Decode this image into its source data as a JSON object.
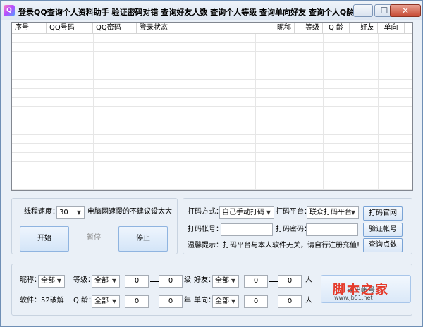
{
  "window": {
    "title": "登录QQ查询个人资料助手   验证密码对错  查询好友人数  查询个人等级  查询单向好友  查询个人Q龄 ...",
    "icon_text": "Q",
    "minimize_glyph": "—",
    "maximize_glyph": "☐",
    "close_glyph": "✕"
  },
  "table": {
    "columns": [
      "序号",
      "QQ号码",
      "QQ密码",
      "登录状态",
      "昵称",
      "等级",
      "Q 龄",
      "好友",
      "单向"
    ]
  },
  "speed": {
    "label": "线程速度：",
    "value": "30",
    "note": "电脑网速慢的不建议设太大"
  },
  "controls": {
    "start": "开始",
    "pause": "暂停",
    "stop": "停止"
  },
  "captcha": {
    "method_label": "打码方式：",
    "method_value": "自己手动打码",
    "platform_label": "打码平台：",
    "platform_value": "联众打码平台",
    "official_button": "打码官网",
    "account_label": "打码帐号：",
    "account_value": "",
    "password_label": "打码密码：",
    "password_value": "",
    "verify_button": "验证帐号",
    "points_button": "查询点数",
    "hint": "温馨提示：打码平台与本人软件无关，请自行注册充值!"
  },
  "filters": {
    "nickname_label": "昵称：",
    "nickname_value": "全部",
    "level_label": "等级：",
    "level_value": "全部",
    "level_min": "0",
    "level_max": "0",
    "level_unit": "级",
    "friends_label": "好友：",
    "friends_value": "全部",
    "friends_min": "0",
    "friends_max": "0",
    "friends_unit": "人",
    "software_label": "软件：52破解",
    "qage_label": "Q 龄：",
    "qage_value": "全部",
    "qage_min": "0",
    "qage_max": "0",
    "qage_unit": "年",
    "oneway_label": "单向：",
    "oneway_value": "全部",
    "oneway_min": "0",
    "oneway_max": "0",
    "oneway_unit": "人",
    "export_button": "导出帐号"
  },
  "watermark": {
    "main": "脚本之家",
    "sub": "www.jb51.net"
  },
  "icons": [
    "app-icon",
    "dropdown-arrow-icon",
    "minimize-icon",
    "maximize-icon",
    "close-icon"
  ]
}
